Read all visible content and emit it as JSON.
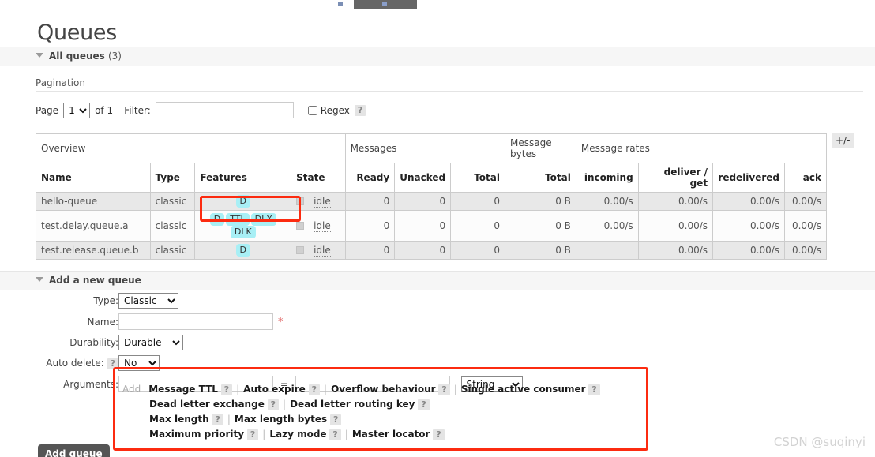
{
  "browser": {
    "tab_label": ""
  },
  "page": {
    "title": "Queues",
    "section_all_queues": "All queues",
    "section_all_queues_count": "(3)",
    "pagination_label": "Pagination",
    "add_queue_section": "Add a new queue"
  },
  "pagination": {
    "page_word": "Page",
    "page_value": "1",
    "of_text": "of 1",
    "filter_label": "- Filter:",
    "filter_value": "",
    "filter_placeholder": "",
    "regex_label": "Regex",
    "help": "?"
  },
  "table": {
    "group_headers": [
      {
        "label": "Overview",
        "span": 4
      },
      {
        "label": "Messages",
        "span": 3
      },
      {
        "label": "Message bytes",
        "span": 1
      },
      {
        "label": "Message rates",
        "span": 4
      }
    ],
    "columns": [
      "Name",
      "Type",
      "Features",
      "State",
      "Ready",
      "Unacked",
      "Total",
      "Total",
      "incoming",
      "deliver / get",
      "redelivered",
      "ack"
    ],
    "plus_minus": "+/-",
    "rows": [
      {
        "name": "hello-queue",
        "type": "classic",
        "features": [
          "D"
        ],
        "state": "idle",
        "ready": "0",
        "unacked": "0",
        "total": "0",
        "bytes_total": "0 B",
        "incoming": "0.00/s",
        "deliver_get": "0.00/s",
        "redelivered": "0.00/s",
        "ack": "0.00/s"
      },
      {
        "name": "test.delay.queue.a",
        "type": "classic",
        "features": [
          "D",
          "TTL",
          "DLX",
          "DLK"
        ],
        "state": "idle",
        "ready": "0",
        "unacked": "0",
        "total": "0",
        "bytes_total": "0 B",
        "incoming": "0.00/s",
        "deliver_get": "0.00/s",
        "redelivered": "0.00/s",
        "ack": "0.00/s"
      },
      {
        "name": "test.release.queue.b",
        "type": "classic",
        "features": [
          "D"
        ],
        "state": "idle",
        "ready": "0",
        "unacked": "0",
        "total": "0",
        "bytes_total": "0 B",
        "incoming": "",
        "deliver_get": "0.00/s",
        "redelivered": "0.00/s",
        "ack": "0.00/s"
      }
    ]
  },
  "form": {
    "type_label": "Type:",
    "type_value": "Classic",
    "name_label": "Name:",
    "name_value": "",
    "name_required": "*",
    "durability_label": "Durability:",
    "durability_value": "Durable",
    "auto_delete_label": "Auto delete:",
    "auto_delete_help": "?",
    "auto_delete_value": "No",
    "arguments_label": "Arguments:",
    "arg_key_value": "",
    "arg_equals": "=",
    "arg_val_value": "",
    "arg_type_value": "String",
    "add_word": "Add",
    "submit_label": "Add queue",
    "preset_rows": [
      [
        {
          "label": "Message TTL",
          "help": "?"
        },
        {
          "label": "Auto expire",
          "help": "?"
        },
        {
          "label": "Overflow behaviour",
          "help": "?"
        },
        {
          "label": "Single active consumer",
          "help": "?"
        }
      ],
      [
        {
          "label": "Dead letter exchange",
          "help": "?"
        },
        {
          "label": "Dead letter routing key",
          "help": "?"
        }
      ],
      [
        {
          "label": "Max length",
          "help": "?"
        },
        {
          "label": "Max length bytes",
          "help": "?"
        }
      ],
      [
        {
          "label": "Maximum priority",
          "help": "?"
        },
        {
          "label": "Lazy mode",
          "help": "?"
        },
        {
          "label": "Master locator",
          "help": "?"
        }
      ]
    ]
  },
  "watermark": "CSDN @suqinyi",
  "colors": {
    "badge": "#a8eff5",
    "highlight": "#fc2b10",
    "row_alt": "#e8e8e8",
    "button": "#555555"
  }
}
